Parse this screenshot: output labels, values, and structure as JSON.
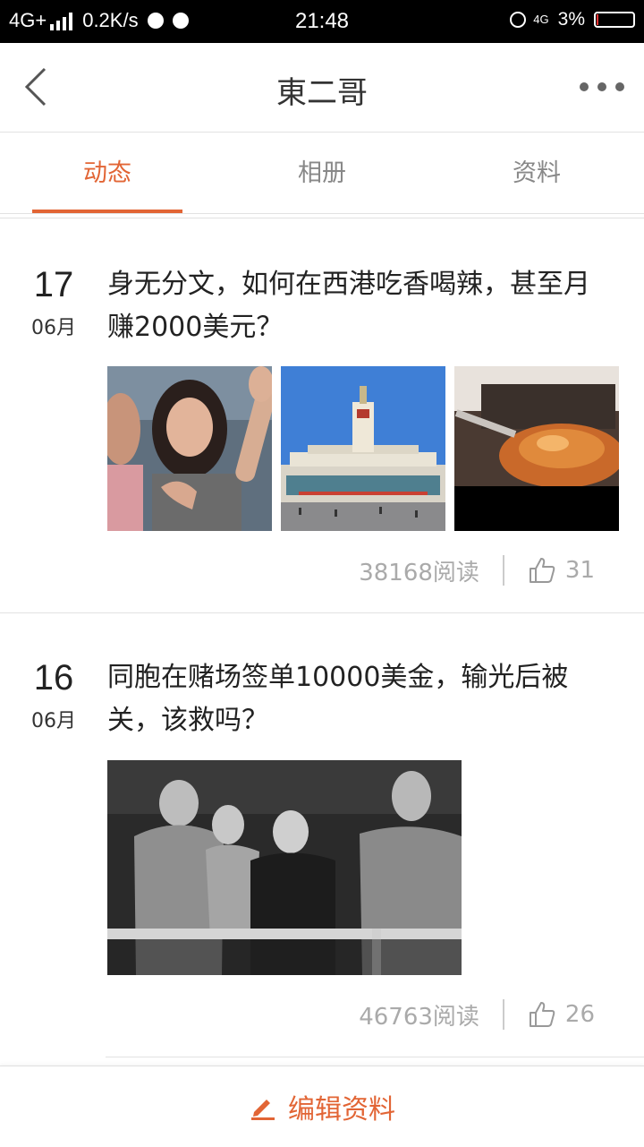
{
  "status_bar": {
    "network": "4G+",
    "speed": "0.2K/s",
    "time": "21:48",
    "net_right": "4G",
    "battery": "3%",
    "battery_level": 0.03
  },
  "header": {
    "title": "東二哥"
  },
  "tabs": [
    {
      "label": "动态",
      "active": true
    },
    {
      "label": "相册",
      "active": false
    },
    {
      "label": "资料",
      "active": false
    }
  ],
  "posts": [
    {
      "day": "17",
      "month": "06月",
      "title": "身无分文，如何在西港吃香喝辣，甚至月赚2000美元？",
      "reads": "38168阅读",
      "likes": "31"
    },
    {
      "day": "16",
      "month": "06月",
      "title": "同胞在赌场签单10000美金，输光后被关，该救吗？",
      "reads": "46763阅读",
      "likes": "26"
    }
  ],
  "bottom_bar": {
    "edit_label": "编辑资料"
  },
  "colors": {
    "accent": "#e26535",
    "muted": "#aaaaaa"
  }
}
